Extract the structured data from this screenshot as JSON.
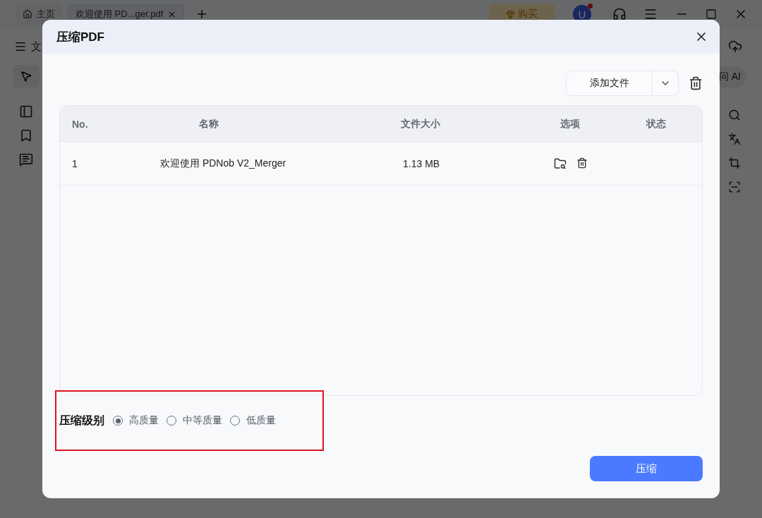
{
  "app": {
    "tabs": [
      {
        "label": "主页",
        "kind": "home",
        "selected": false
      },
      {
        "label": "欢迎使用 PD...ger.pdf",
        "kind": "doc",
        "selected": true
      }
    ],
    "buy": "购买",
    "avatar": "U",
    "menu_label": "文",
    "ai_label": "问 AI"
  },
  "dialog": {
    "title": "压缩PDF",
    "add_button": "添加文件",
    "columns": [
      "No.",
      "名称",
      "文件大小",
      "选项",
      "状态"
    ],
    "rows": [
      {
        "no": "1",
        "name": "欢迎使用 PDNob V2_Merger",
        "size": "1.13 MB"
      }
    ],
    "level_label": "压缩级别",
    "options": [
      {
        "label": "高质量",
        "selected": true
      },
      {
        "label": "中等质量",
        "selected": false
      },
      {
        "label": "低质量",
        "selected": false
      }
    ],
    "submit": "压缩"
  }
}
